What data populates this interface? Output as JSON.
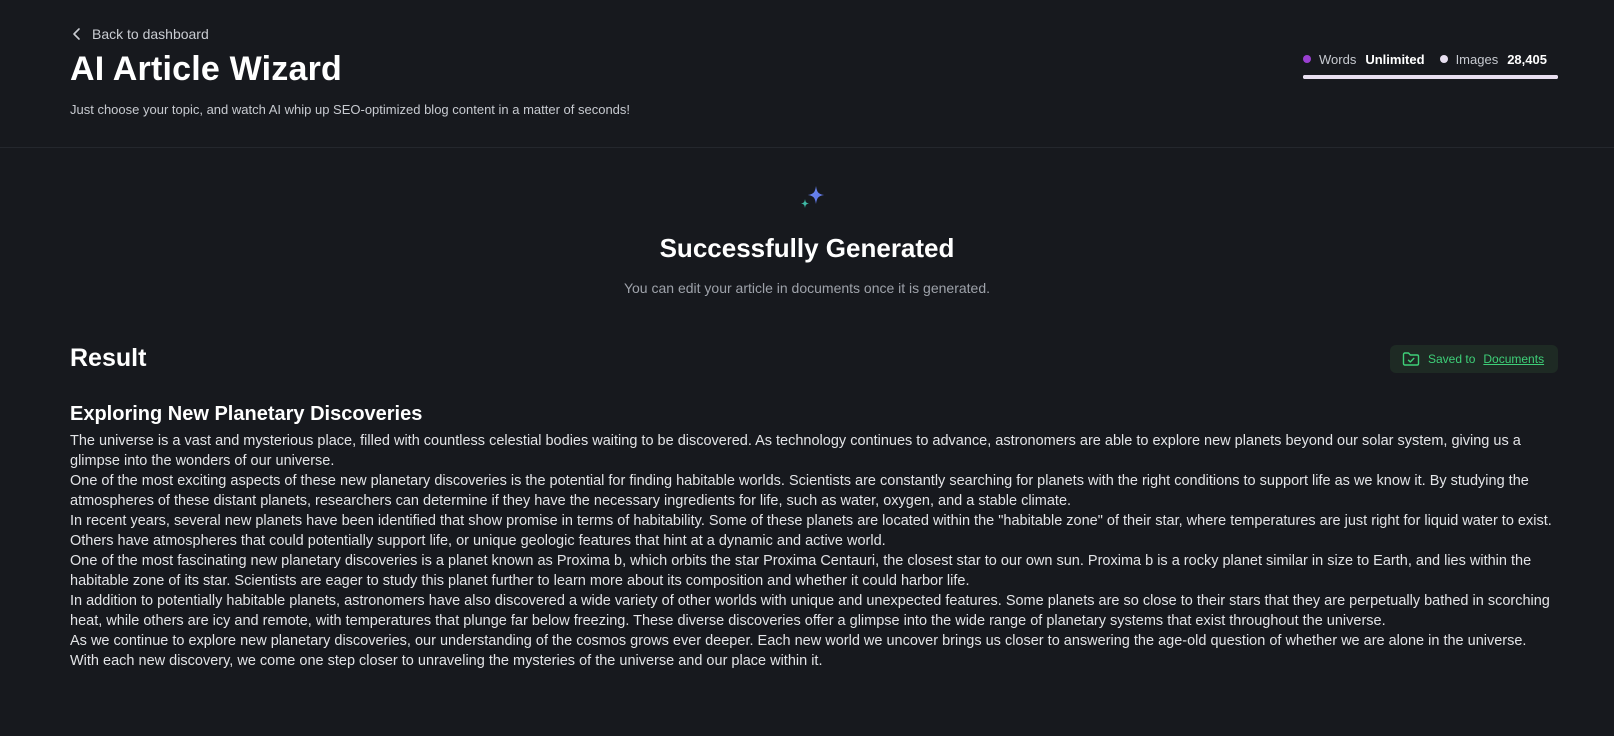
{
  "header": {
    "back_label": "Back to dashboard",
    "title": "AI Article Wizard",
    "subtitle": "Just choose your topic, and watch AI whip up SEO-optimized blog content in a matter of seconds!"
  },
  "usage": {
    "words_label": "Words",
    "words_value": "Unlimited",
    "images_label": "Images",
    "images_value": "28,405",
    "colors": {
      "words_dot": "#9a3fd1",
      "images_dot": "#e8dff0"
    }
  },
  "hero": {
    "icon": "sparkle-icon",
    "title": "Successfully Generated",
    "note": "You can edit your article in documents once it is generated."
  },
  "result": {
    "title": "Result",
    "saved_prefix": "Saved to",
    "saved_link": "Documents",
    "saved_icon": "folder-check-icon",
    "accent": "#3ecf78"
  },
  "article": {
    "heading": "Exploring New Planetary Discoveries",
    "paragraphs": [
      "The universe is a vast and mysterious place, filled with countless celestial bodies waiting to be discovered. As technology continues to advance, astronomers are able to explore new planets beyond our solar system, giving us a glimpse into the wonders of our universe.",
      "One of the most exciting aspects of these new planetary discoveries is the potential for finding habitable worlds. Scientists are constantly searching for planets with the right conditions to support life as we know it. By studying the atmospheres of these distant planets, researchers can determine if they have the necessary ingredients for life, such as water, oxygen, and a stable climate.",
      "In recent years, several new planets have been identified that show promise in terms of habitability. Some of these planets are located within the \"habitable zone\" of their star, where temperatures are just right for liquid water to exist. Others have atmospheres that could potentially support life, or unique geologic features that hint at a dynamic and active world.",
      "One of the most fascinating new planetary discoveries is a planet known as Proxima b, which orbits the star Proxima Centauri, the closest star to our own sun. Proxima b is a rocky planet similar in size to Earth, and lies within the habitable zone of its star. Scientists are eager to study this planet further to learn more about its composition and whether it could harbor life.",
      "In addition to potentially habitable planets, astronomers have also discovered a wide variety of other worlds with unique and unexpected features. Some planets are so close to their stars that they are perpetually bathed in scorching heat, while others are icy and remote, with temperatures that plunge far below freezing. These diverse discoveries offer a glimpse into the wide range of planetary systems that exist throughout the universe.",
      "As we continue to explore new planetary discoveries, our understanding of the cosmos grows ever deeper. Each new world we uncover brings us closer to answering the age-old question of whether we are alone in the universe. With each new discovery, we come one step closer to unraveling the mysteries of the universe and our place within it."
    ]
  }
}
